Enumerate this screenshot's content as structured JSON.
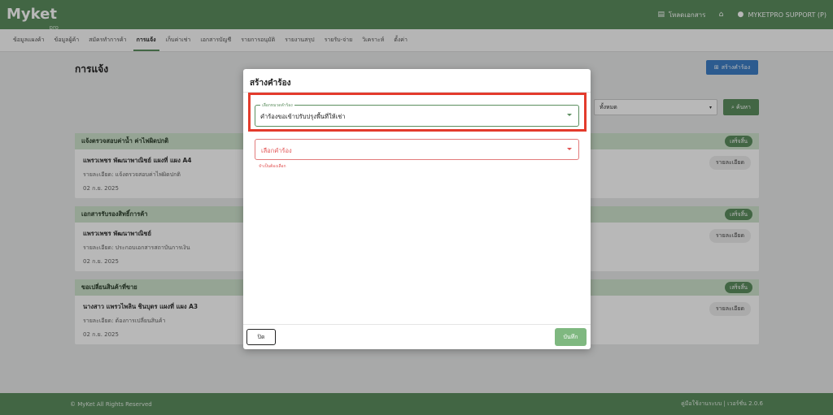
{
  "header": {
    "logo_text": "Myket",
    "logo_sub": "pro",
    "link_download": "โหลดเอกสาร",
    "user": "MYKETPRO SUPPORT (P)"
  },
  "nav": {
    "tabs": [
      "ข้อมูลแผงค้า",
      "ข้อมูลผู้ค้า",
      "สมัครทำการค้า",
      "การแจ้ง",
      "เก็บค่าเช่า",
      "เอกสารบัญชี",
      "รายการอนุมัติ",
      "รายงานสรุป",
      "รายรับ-จ่าย",
      "วิเคราะห์",
      "ตั้งค่า"
    ],
    "active_index": 3
  },
  "page": {
    "title": "การแจ้ง",
    "create_button": "สร้างคำร้อง",
    "filter_value": "ทั้งหมด",
    "search_button": "ค้นหา"
  },
  "cards": [
    {
      "header": "แจ้งตรวจสอบค่าน้ำ ค่าไฟผิดปกติ",
      "badge": "เสร็จสิ้น",
      "name": "แพรวเพชร พัฒนาพาณิชย์ แผงที่ แผง A4",
      "detail": "รายละเอียด: แจ้งตรวจสอบค่าไฟผิดปกติ",
      "date": "02 ก.ย. 2025",
      "detail_button": "รายละเอียด"
    },
    {
      "header": "เอกสารรับรองสิทธิ์การค้า",
      "badge": "เสร็จสิ้น",
      "name": "แพรวเพชร พัฒนาพาณิชย์",
      "detail": "รายละเอียด: ประกอบเอกสารสถาบันการเงิน",
      "date": "02 ก.ย. 2025",
      "detail_button": "รายละเอียด"
    },
    {
      "header": "ขอเปลี่ยนสินค้าที่ขาย",
      "badge": "เสร็จสิ้น",
      "name": "นางสาว แพรวไพลิน ชินบุตร แผงที่ แผง A3",
      "detail": "รายละเอียด: ต้องการเปลี่ยนสินค้า",
      "date": "02 ก.ย. 2025",
      "detail_button": "รายละเอียด"
    }
  ],
  "footer": {
    "copyright": "© MyKet All Rights Reserved",
    "version": "คู่มือใช้งานระบบ | เวอร์ชั่น 2.0.6"
  },
  "modal": {
    "title": "สร้างคำร้อง",
    "category_label": "เลือกหมวดคำร้อง",
    "category_value": "คำร้องขอเข้าปรับปรุงพื้นที่ให้เช่า",
    "request_placeholder": "เลือกคำร้อง",
    "error_text": "จำเป็นต้องเลือก",
    "close_button": "ปิด",
    "save_button": "บันทึก"
  },
  "colors": {
    "brand_green": "#5c8e5f",
    "highlight_red": "#e33b2c",
    "error_red": "#e25454",
    "create_blue": "#3e7fc6"
  }
}
